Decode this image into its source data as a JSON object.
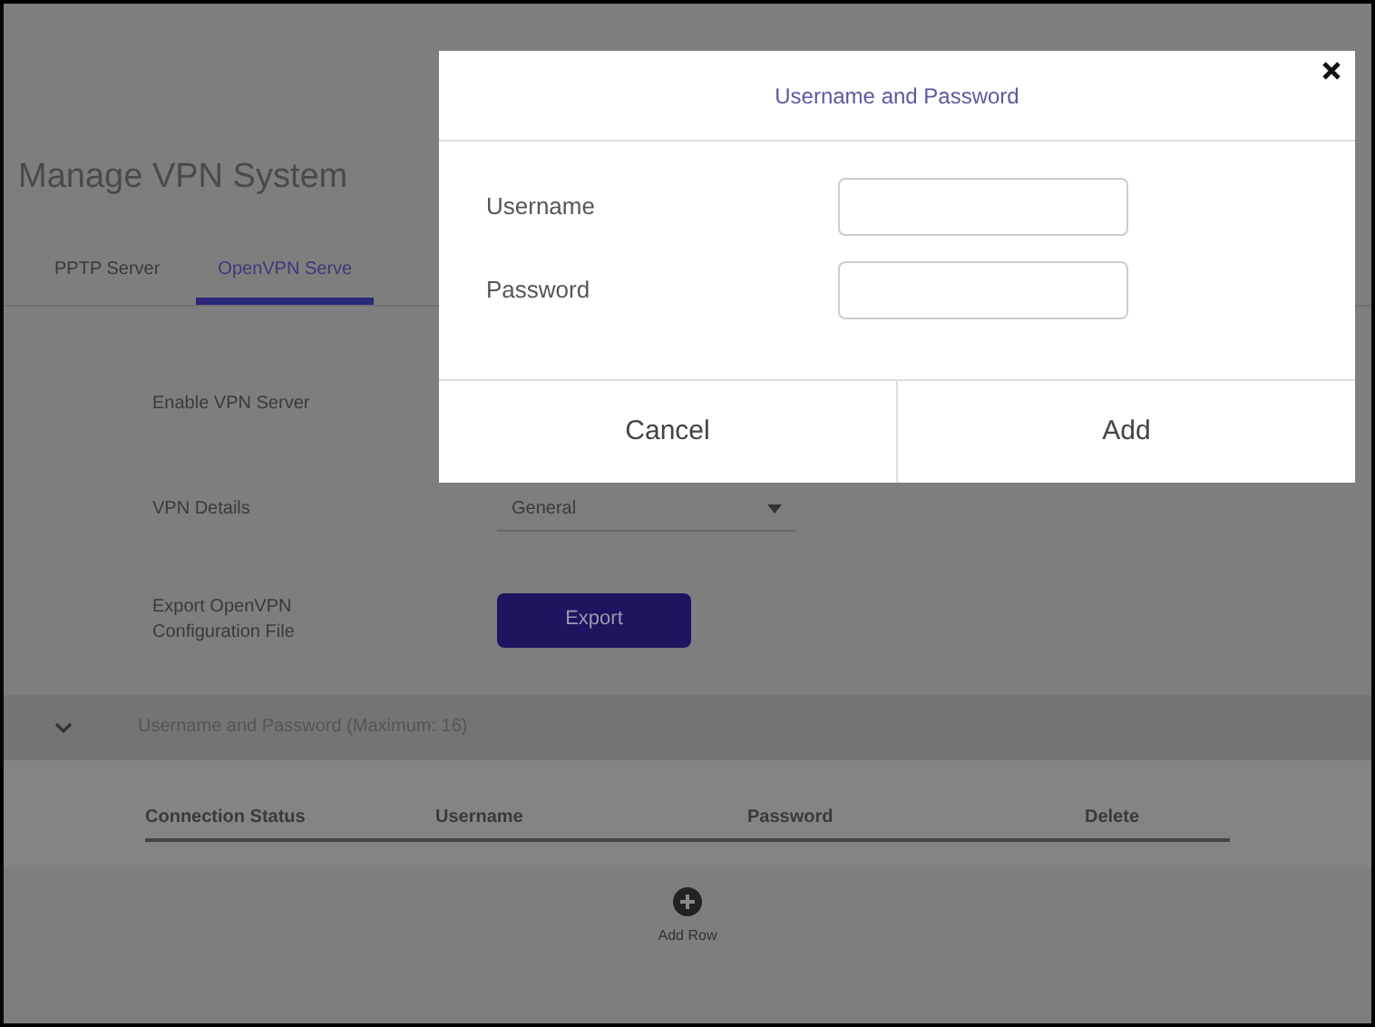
{
  "page": {
    "title": "Manage VPN System"
  },
  "tabs": [
    {
      "label": "PPTP Server",
      "selected": false
    },
    {
      "label": "OpenVPN Serve",
      "selected": true
    }
  ],
  "settings": [
    {
      "kind": "label",
      "label": "Enable VPN Server"
    },
    {
      "kind": "select",
      "label": "VPN Details",
      "value": "General"
    },
    {
      "kind": "button",
      "label": "Export OpenVPN Configuration File",
      "button": "Export"
    }
  ],
  "section": {
    "title": "Username and Password (Maximum: 16)",
    "expanded": true
  },
  "table": {
    "columns": [
      "Connection Status",
      "Username",
      "Password",
      "Delete"
    ]
  },
  "add_row": {
    "label": "Add Row"
  },
  "dialog": {
    "title": "Username and Password",
    "fields": [
      {
        "label": "Username"
      },
      {
        "label": "Password"
      }
    ],
    "buttons": [
      "Cancel",
      "Add"
    ]
  }
}
